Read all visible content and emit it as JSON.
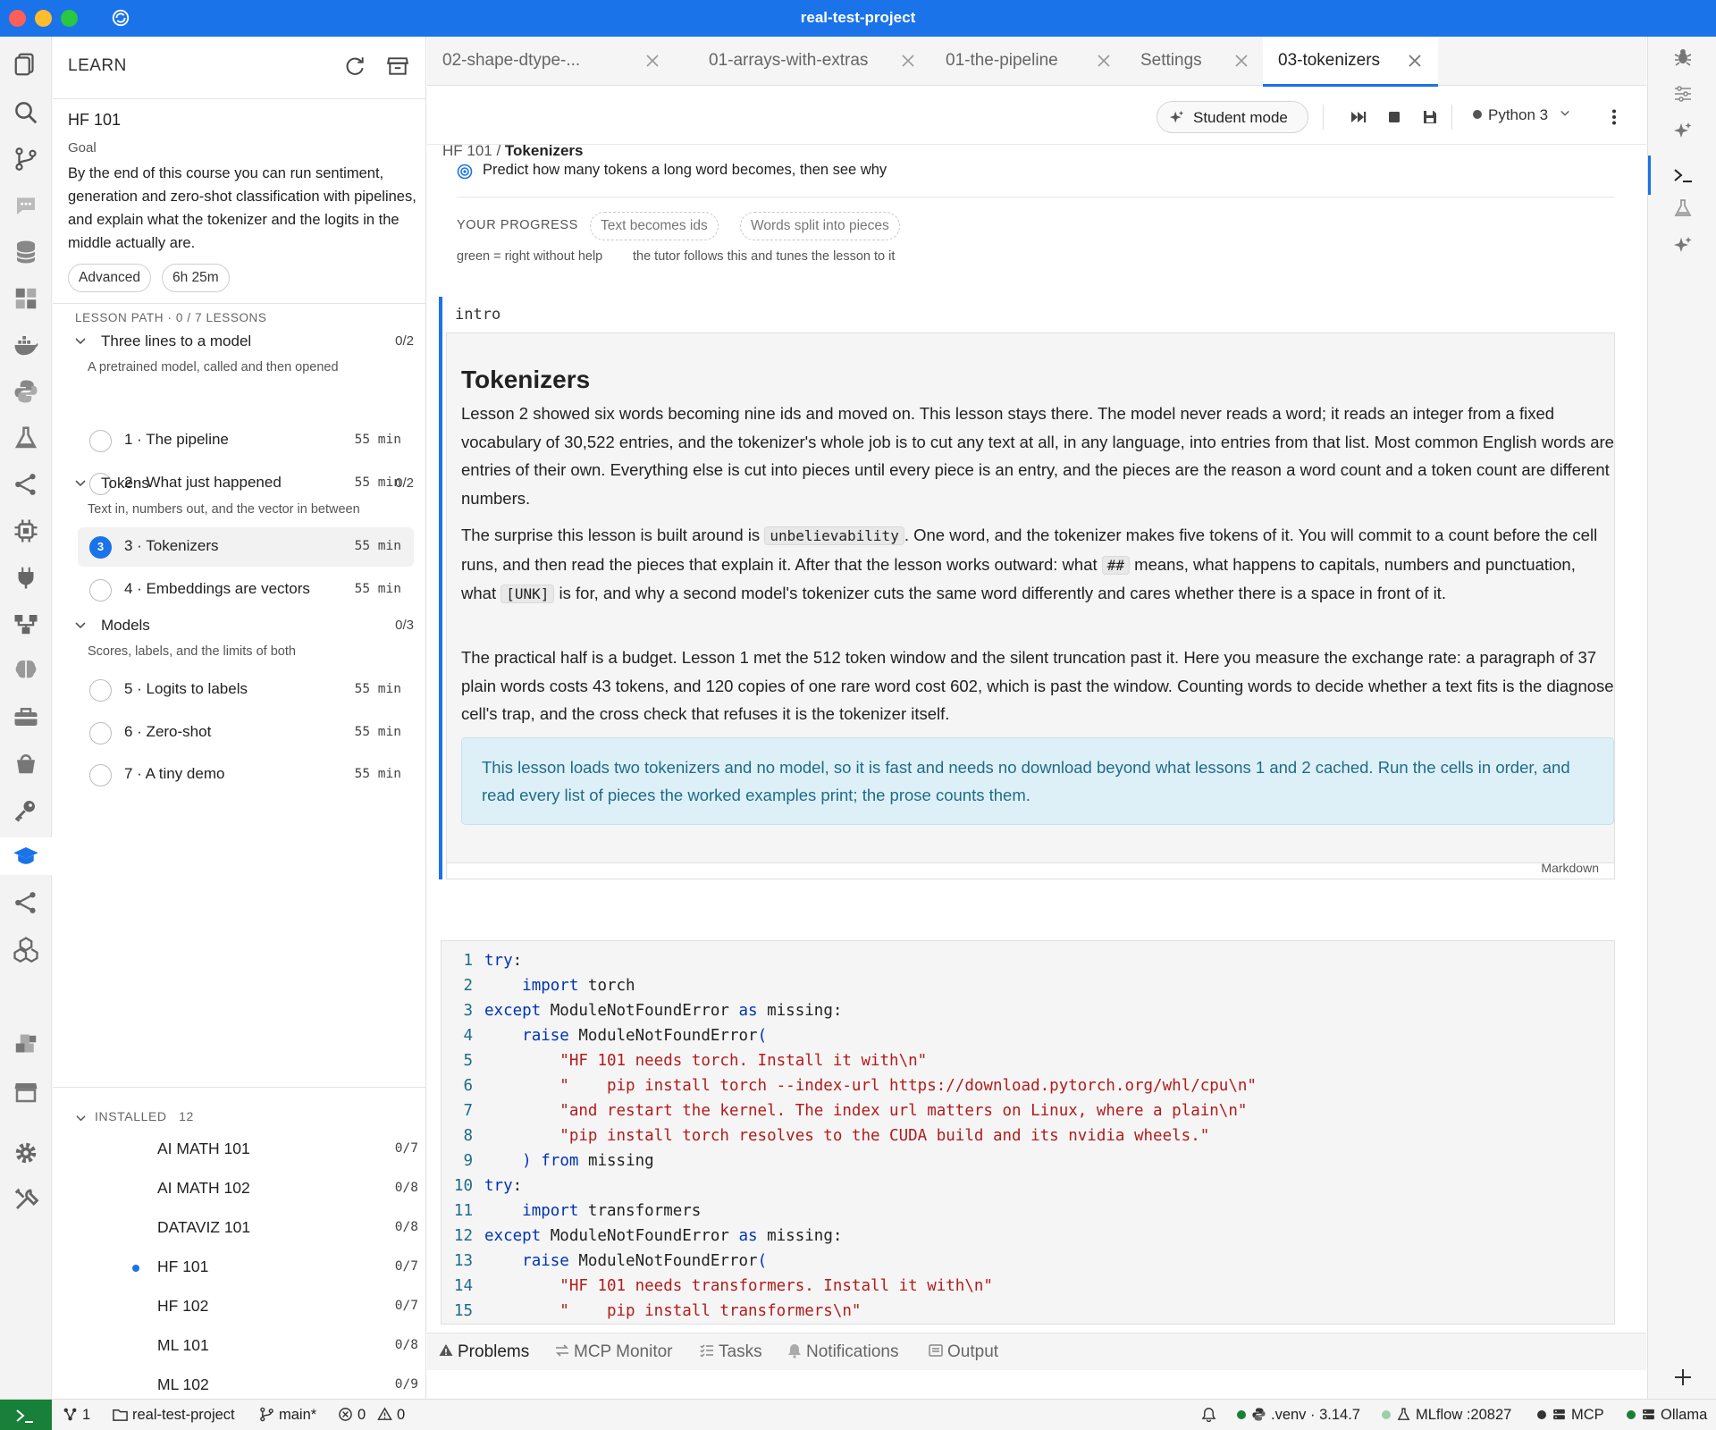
{
  "window": {
    "title": "real-test-project"
  },
  "sidebar": {
    "header": "LEARN",
    "course": {
      "title": "HF 101",
      "goal_label": "Goal",
      "goal_text": "By the end of this course you can run sentiment, generation and zero-shot classification with pipelines, and explain what the tokenizer and the logits in the middle actually are.",
      "level": "Advanced",
      "duration": "6h 25m"
    },
    "path_label": "LESSON PATH · 0 / 7 LESSONS",
    "modules": [
      {
        "name": "Three lines to a model",
        "count": "0/2",
        "sub": "A pretrained model, called and then opened",
        "lessons": [
          {
            "name": "1 · The pipeline",
            "dur": "55 min"
          },
          {
            "name": "2 · What just happened",
            "dur": "55 min"
          }
        ]
      },
      {
        "name": "Tokens",
        "count": "0/2",
        "sub": "Text in, numbers out, and the vector in between",
        "lessons": [
          {
            "name": "3 · Tokenizers",
            "dur": "55 min",
            "badge": "3"
          },
          {
            "name": "4 · Embeddings are vectors",
            "dur": "55 min"
          }
        ]
      },
      {
        "name": "Models",
        "count": "0/3",
        "sub": "Scores, labels, and the limits of both",
        "lessons": [
          {
            "name": "5 · Logits to labels",
            "dur": "55 min"
          },
          {
            "name": "6 · Zero-shot",
            "dur": "55 min"
          },
          {
            "name": "7 · A tiny demo",
            "dur": "55 min"
          }
        ]
      }
    ],
    "installed_label": "INSTALLED",
    "installed_count": "12",
    "installed": [
      {
        "name": "AI MATH 101",
        "count": "0/7"
      },
      {
        "name": "AI MATH 102",
        "count": "0/8"
      },
      {
        "name": "DATAVIZ 101",
        "count": "0/8"
      },
      {
        "name": "HF 101",
        "count": "0/7"
      },
      {
        "name": "HF 102",
        "count": "0/7"
      },
      {
        "name": "ML 101",
        "count": "0/8"
      },
      {
        "name": "ML 102",
        "count": "0/9"
      }
    ]
  },
  "tabs": [
    {
      "label": "02-shape-dtype-..."
    },
    {
      "label": "01-arrays-with-extras"
    },
    {
      "label": "01-the-pipeline"
    },
    {
      "label": "Settings"
    },
    {
      "label": "03-tokenizers"
    }
  ],
  "toolbar": {
    "crumb_root": "HF 101",
    "crumb_sep": " / ",
    "crumb_current": "Tokenizers",
    "student_mode": "Student mode",
    "kernel": "Python 3"
  },
  "lesson": {
    "predict": "Predict how many tokens a long word becomes, then see why",
    "progress_label": "YOUR PROGRESS",
    "chips": [
      "Text becomes ids",
      "Words split into pieces"
    ],
    "note_left": "green = right without help",
    "note_right": "the tutor follows this and tunes the lesson to it"
  },
  "md_cell": {
    "tag": "intro",
    "title": "Tokenizers",
    "p1": "Lesson 2 showed six words becoming nine ids and moved on. This lesson stays there. The model never reads a word; it reads an integer from a fixed vocabulary of 30,522 entries, and the tokenizer's whole job is to cut any text at all, in any language, into entries from that list. Most common English words are entries of their own. Everything else is cut into pieces until every piece is an entry, and the pieces are the reason a word count and a token count are different numbers.",
    "p2_a": "The surprise this lesson is built around is ",
    "p2_code1": "unbelievability",
    "p2_b": ". One word, and the tokenizer makes five tokens of it. You will commit to a count before the cell runs, and then read the pieces that explain it. After that the lesson works outward: what ",
    "p2_code2": "##",
    "p2_c": " means, what happens to capitals, numbers and punctuation, what ",
    "p2_code3": "[UNK]",
    "p2_d": " is for, and why a second model's tokenizer cuts the same word differently and cares whether there is a space in front of it.",
    "p3": "The practical half is a budget. Lesson 1 met the 512 token window and the silent truncation past it. Here you measure the exchange rate: a paragraph of 37 plain words costs 43 tokens, and 120 copies of one rare word cost 602, which is past the window. Counting words to decide whether a text fits is the diagnose cell's trap, and the cross check that refuses it is the tokenizer itself.",
    "callout": "This lesson loads two tokenizers and no model, so it is fast and needs no download beyond what lessons 1 and 2 cached. Run the cells in order, and read every list of pieces the worked examples print; the prose counts them.",
    "type_label": "Markdown"
  },
  "code_cell": {
    "lines": [
      {
        "n": "1",
        "parts": [
          [
            "kw",
            "try"
          ],
          [
            "",
            ":"
          ]
        ]
      },
      {
        "n": "2",
        "parts": [
          [
            "",
            "    "
          ],
          [
            "kw",
            "import"
          ],
          [
            "",
            " torch"
          ]
        ]
      },
      {
        "n": "3",
        "parts": [
          [
            "kw",
            "except"
          ],
          [
            "",
            " ModuleNotFoundError "
          ],
          [
            "kw",
            "as"
          ],
          [
            "",
            " missing:"
          ]
        ]
      },
      {
        "n": "4",
        "parts": [
          [
            "",
            "    "
          ],
          [
            "kw",
            "raise"
          ],
          [
            "",
            " ModuleNotFoundError"
          ],
          [
            "kw",
            "("
          ]
        ]
      },
      {
        "n": "5",
        "parts": [
          [
            "",
            "        "
          ],
          [
            "str",
            "\"HF 101 needs torch. Install it with\\n\""
          ]
        ]
      },
      {
        "n": "6",
        "parts": [
          [
            "",
            "        "
          ],
          [
            "str",
            "\"    pip install torch --index-url https://download.pytorch.org/whl/cpu\\n\""
          ]
        ]
      },
      {
        "n": "7",
        "parts": [
          [
            "",
            "        "
          ],
          [
            "str",
            "\"and restart the kernel. The index url matters on Linux, where a plain\\n\""
          ]
        ]
      },
      {
        "n": "8",
        "parts": [
          [
            "",
            "        "
          ],
          [
            "str",
            "\"pip install torch resolves to the CUDA build and its nvidia wheels.\""
          ]
        ]
      },
      {
        "n": "9",
        "parts": [
          [
            "",
            "    "
          ],
          [
            "kw",
            ")"
          ],
          [
            "",
            " "
          ],
          [
            "kw",
            "from"
          ],
          [
            "",
            " missing"
          ]
        ]
      },
      {
        "n": "10",
        "parts": [
          [
            "kw",
            "try"
          ],
          [
            "",
            ":"
          ]
        ]
      },
      {
        "n": "11",
        "parts": [
          [
            "",
            "    "
          ],
          [
            "kw",
            "import"
          ],
          [
            "",
            " transformers"
          ]
        ]
      },
      {
        "n": "12",
        "parts": [
          [
            "kw",
            "except"
          ],
          [
            "",
            " ModuleNotFoundError "
          ],
          [
            "kw",
            "as"
          ],
          [
            "",
            " missing:"
          ]
        ]
      },
      {
        "n": "13",
        "parts": [
          [
            "",
            "    "
          ],
          [
            "kw",
            "raise"
          ],
          [
            "",
            " ModuleNotFoundError"
          ],
          [
            "kw",
            "("
          ]
        ]
      },
      {
        "n": "14",
        "parts": [
          [
            "",
            "        "
          ],
          [
            "str",
            "\"HF 101 needs transformers. Install it with\\n\""
          ]
        ]
      },
      {
        "n": "15",
        "parts": [
          [
            "",
            "        "
          ],
          [
            "str",
            "\"    pip install transformers\\n\""
          ]
        ]
      }
    ]
  },
  "panel": {
    "tabs": [
      "Problems",
      "MCP Monitor",
      "Tasks",
      "Notifications",
      "Output"
    ]
  },
  "status": {
    "ports": "1",
    "folder": "real-test-project",
    "branch": "main*",
    "errors": "0",
    "warnings": "0",
    "venv": ".venv · 3.14.7",
    "mlflow": "MLflow :20827",
    "mcp": "MCP",
    "ollama": "Ollama"
  },
  "colors": {
    "accent": "#1a73e8",
    "status_green": "#188038",
    "callout_bg": "#def0f7"
  }
}
